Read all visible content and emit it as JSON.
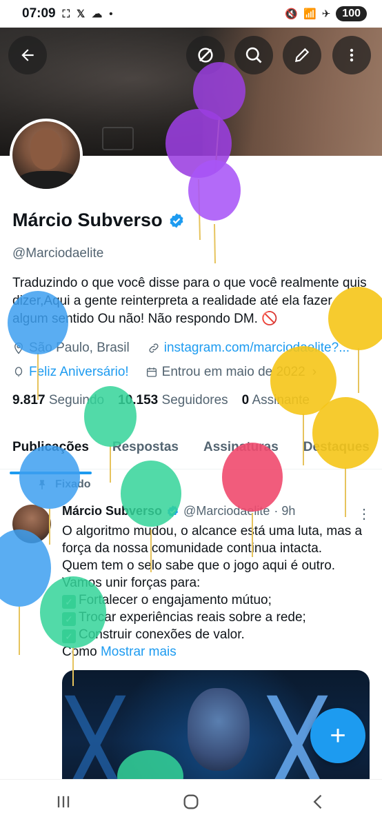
{
  "status_bar": {
    "time": "07:09",
    "battery": "100"
  },
  "profile": {
    "name": "Márcio Subverso",
    "handle": "@Marciodaelite",
    "bio": "Traduzindo o que você disse para o que você realmente quis dizer,Aqui a gente reinterpreta a realidade até ela fazer algum sentido Ou não!  Não respondo DM. 🚫",
    "location": "São Paulo, Brasil",
    "website": "instagram.com/marciodaelite?...",
    "birthday": "Feliz Aniversário!",
    "joined": "Entrou em maio de 2022",
    "following_count": "9.817",
    "following_label": "Seguindo",
    "followers_count": "10.153",
    "followers_label": "Seguidores",
    "subscribers_count": "0",
    "subscribers_label": "Assinante"
  },
  "tabs": [
    "Publicações",
    "Respostas",
    "Assinaturas",
    "Destaques"
  ],
  "post": {
    "pinned_label": "Fixado",
    "author": "Márcio Subverso",
    "handle": "@Marciodaelite",
    "time": "· 9h",
    "line1": "O algoritmo mudou, o alcance está uma luta, mas a força da nossa comunidade continua intacta.",
    "line2": "Quem tem o selo sabe que o jogo aqui é outro.",
    "line3": "Vamos unir forças para:",
    "item1": "Fortalecer o engajamento mútuo;",
    "item2": "Trocar experiências reais sobre a rede;",
    "item3": "Construir conexões de valor.",
    "tail": "Como",
    "show_more": "Mostrar mais"
  },
  "colors": {
    "accent": "#1d9bf0",
    "balloon_purple": "#9b3fe0",
    "balloon_blue": "#3d9ff0",
    "balloon_yellow": "#f5c518",
    "balloon_green": "#34d399",
    "balloon_red": "#f04a6e"
  },
  "icons": {
    "back": "arrow-left-icon",
    "grok": "grok-icon",
    "search": "search-icon",
    "edit": "edit-icon",
    "more": "more-vertical-icon",
    "compose": "plus-icon"
  }
}
